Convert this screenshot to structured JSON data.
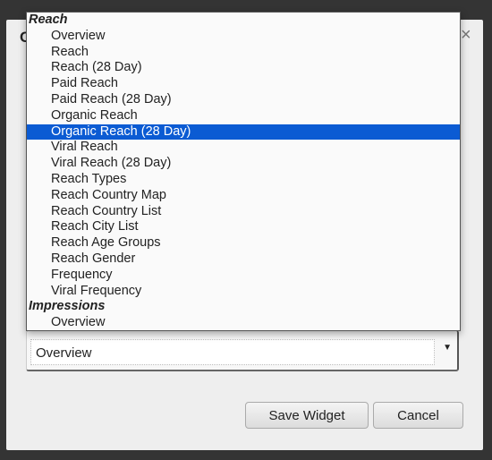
{
  "dialog": {
    "title_fragment": "C",
    "close_icon": "close-icon"
  },
  "dropdown": {
    "selected_index": 6,
    "highlight_color": "#0b5bd3",
    "rows": [
      {
        "type": "group",
        "label": "Reach"
      },
      {
        "type": "option",
        "label": "Overview"
      },
      {
        "type": "option",
        "label": "Reach"
      },
      {
        "type": "option",
        "label": "Reach (28 Day)"
      },
      {
        "type": "option",
        "label": "Paid Reach"
      },
      {
        "type": "option",
        "label": "Paid Reach (28 Day)"
      },
      {
        "type": "option",
        "label": "Organic Reach"
      },
      {
        "type": "option",
        "label": "Organic Reach (28 Day)"
      },
      {
        "type": "option",
        "label": "Viral Reach"
      },
      {
        "type": "option",
        "label": "Viral Reach (28 Day)"
      },
      {
        "type": "option",
        "label": "Reach Types"
      },
      {
        "type": "option",
        "label": "Reach Country Map"
      },
      {
        "type": "option",
        "label": "Reach Country List"
      },
      {
        "type": "option",
        "label": "Reach City List"
      },
      {
        "type": "option",
        "label": "Reach Age Groups"
      },
      {
        "type": "option",
        "label": "Reach Gender"
      },
      {
        "type": "option",
        "label": "Frequency"
      },
      {
        "type": "option",
        "label": "Viral Frequency"
      },
      {
        "type": "group",
        "label": "Impressions"
      },
      {
        "type": "option",
        "label": "Overview"
      }
    ]
  },
  "select": {
    "value": "Overview"
  },
  "buttons": {
    "save": "Save Widget",
    "cancel": "Cancel"
  }
}
